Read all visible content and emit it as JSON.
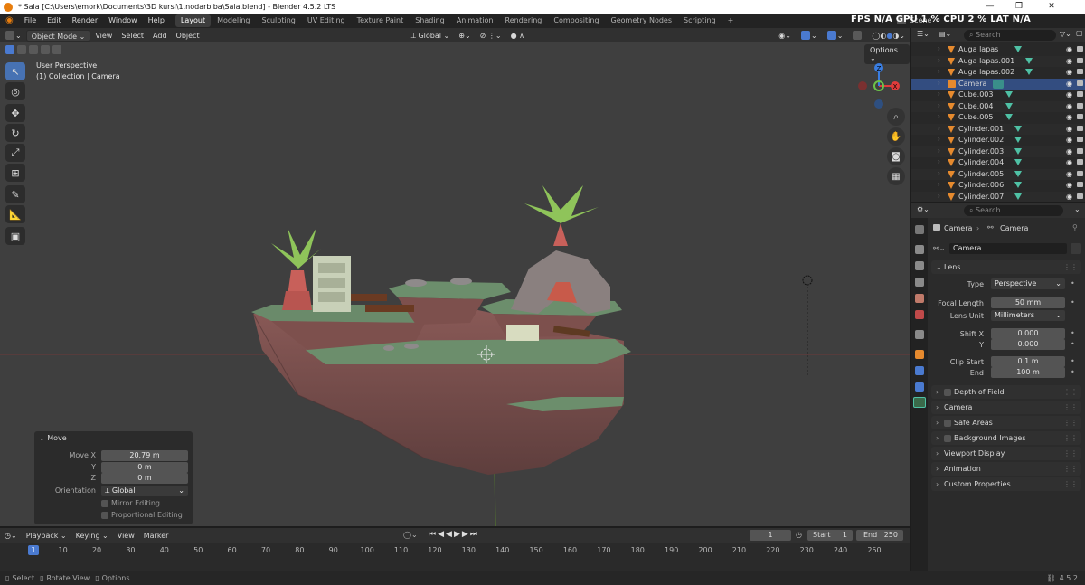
{
  "window": {
    "title": "* Sala [C:\\Users\\emork\\Documents\\3D kursi\\1.nodarbiba\\Sala.blend] - Blender 4.5.2 LTS"
  },
  "menu": {
    "items": [
      "File",
      "Edit",
      "Render",
      "Window",
      "Help"
    ],
    "workspaces": [
      "Layout",
      "Modeling",
      "Sculpting",
      "UV Editing",
      "Texture Paint",
      "Shading",
      "Animation",
      "Rendering",
      "Compositing",
      "Geometry Nodes",
      "Scripting"
    ],
    "active_workspace": "Layout",
    "scene_label": "Scene",
    "hud_stats": "FPS  N/A  GPU  1 %  CPU  2 %  LAT  N/A"
  },
  "viewport_header": {
    "mode": "Object Mode",
    "menus": [
      "View",
      "Select",
      "Add",
      "Object"
    ],
    "transform_orientation": "Global",
    "options_label": "Options"
  },
  "viewport": {
    "perspective_label": "User Perspective",
    "context_label": "(1) Collection | Camera",
    "gizmo_axes": [
      "X",
      "Y",
      "Z"
    ]
  },
  "move_panel": {
    "title": "Move",
    "move_x_label": "Move X",
    "move_x_value": "20.79 m",
    "y_label": "Y",
    "y_value": "0 m",
    "z_label": "Z",
    "z_value": "0 m",
    "orientation_label": "Orientation",
    "orientation_value": "Global",
    "mirror_label": "Mirror Editing",
    "proportional_label": "Proportional Editing"
  },
  "timeline": {
    "menus": [
      "Playback",
      "Keying",
      "View",
      "Marker"
    ],
    "current_frame": "1",
    "start_label": "Start",
    "start_value": "1",
    "end_label": "End",
    "end_value": "250",
    "ticks": [
      "1",
      "10",
      "20",
      "30",
      "40",
      "50",
      "60",
      "70",
      "80",
      "90",
      "100",
      "110",
      "120",
      "130",
      "140",
      "150",
      "160",
      "170",
      "180",
      "190",
      "200",
      "210",
      "220",
      "230",
      "240",
      "250"
    ]
  },
  "statusbar": {
    "select": "Select",
    "rotate": "Rotate View",
    "options": "Options",
    "version": "4.5.2"
  },
  "outliner": {
    "search_placeholder": "Search",
    "items": [
      {
        "name": "Auga lapas",
        "selected": false
      },
      {
        "name": "Auga lapas.001",
        "selected": false
      },
      {
        "name": "Auga lapas.002",
        "selected": false
      },
      {
        "name": "Camera",
        "selected": true
      },
      {
        "name": "Cube.003",
        "selected": false
      },
      {
        "name": "Cube.004",
        "selected": false
      },
      {
        "name": "Cube.005",
        "selected": false
      },
      {
        "name": "Cylinder.001",
        "selected": false
      },
      {
        "name": "Cylinder.002",
        "selected": false
      },
      {
        "name": "Cylinder.003",
        "selected": false
      },
      {
        "name": "Cylinder.004",
        "selected": false
      },
      {
        "name": "Cylinder.005",
        "selected": false
      },
      {
        "name": "Cylinder.006",
        "selected": false
      },
      {
        "name": "Cylinder.007",
        "selected": false
      }
    ]
  },
  "properties": {
    "search_placeholder": "Search",
    "breadcrumb_object": "Camera",
    "breadcrumb_data": "Camera",
    "datablock_name": "Camera",
    "lens_section": "Lens",
    "type_label": "Type",
    "type_value": "Perspective",
    "focal_label": "Focal Length",
    "focal_value": "50 mm",
    "lens_unit_label": "Lens Unit",
    "lens_unit_value": "Millimeters",
    "shift_x_label": "Shift X",
    "shift_x_value": "0.000",
    "shift_y_label": "Y",
    "shift_y_value": "0.000",
    "clip_start_label": "Clip Start",
    "clip_start_value": "0.1 m",
    "clip_end_label": "End",
    "clip_end_value": "100 m",
    "sections": [
      "Depth of Field",
      "Camera",
      "Safe Areas",
      "Background Images",
      "Viewport Display",
      "Animation",
      "Custom Properties"
    ]
  },
  "colors": {
    "accent": "#4772b3",
    "selection": "#334d80",
    "object_icon": "#e68a2e",
    "mesh_data_icon": "#4fc1a5"
  }
}
